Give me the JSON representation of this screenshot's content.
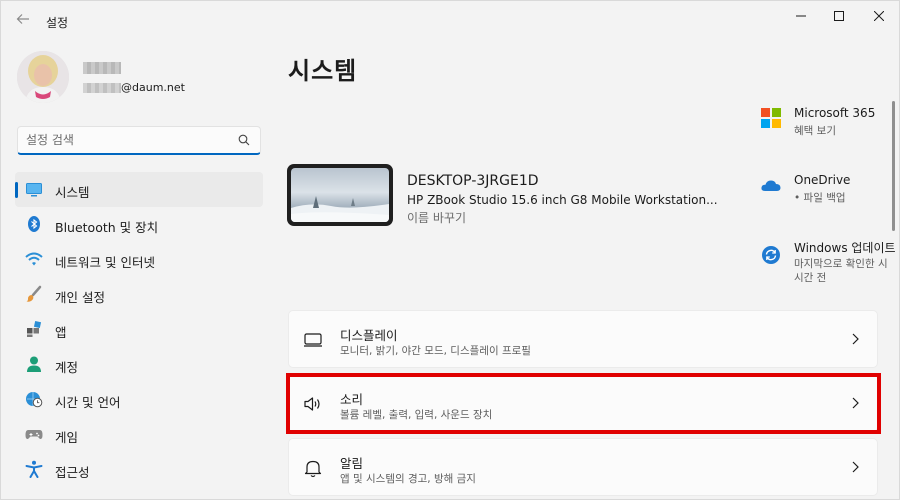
{
  "window": {
    "app_title": "설정",
    "controls": [
      "minimize-icon",
      "maximize-icon",
      "close-icon"
    ]
  },
  "profile": {
    "email_suffix": "@daum.net"
  },
  "search": {
    "placeholder": "설정 검색",
    "icon": "search-icon"
  },
  "sidebar": {
    "items": [
      {
        "label": "시스템",
        "icon": "monitor-icon",
        "active": true
      },
      {
        "label": "Bluetooth 및 장치",
        "icon": "bluetooth-icon"
      },
      {
        "label": "네트워크 및 인터넷",
        "icon": "wifi-icon"
      },
      {
        "label": "개인 설정",
        "icon": "brush-icon"
      },
      {
        "label": "앱",
        "icon": "apps-icon"
      },
      {
        "label": "계정",
        "icon": "account-icon"
      },
      {
        "label": "시간 및 언어",
        "icon": "globe-clock-icon"
      },
      {
        "label": "게임",
        "icon": "gamepad-icon"
      },
      {
        "label": "접근성",
        "icon": "accessibility-icon"
      }
    ]
  },
  "main": {
    "title": "시스템",
    "device": {
      "name": "DESKTOP-3JRGE1D",
      "model": "HP ZBook Studio 15.6 inch G8 Mobile Workstation...",
      "rename": "이름 바꾸기"
    },
    "side_cards": [
      {
        "title": "Microsoft 365",
        "sub": "혜택 보기",
        "icon": "microsoft-365-icon"
      },
      {
        "title": "OneDrive",
        "sub": "• 파일 백업",
        "icon": "onedrive-icon"
      },
      {
        "title": "Windows 업데이트",
        "sub": "마지막으로 확인한 시",
        "sub2": "시간 전",
        "icon": "windows-update-icon"
      }
    ],
    "settings": [
      {
        "title": "디스플레이",
        "sub": "모니터, 밝기, 야간 모드, 디스플레이 프로필",
        "icon": "display-icon"
      },
      {
        "title": "소리",
        "sub": "볼륨 레벨, 출력, 입력, 사운드 장치",
        "icon": "speaker-icon"
      },
      {
        "title": "알림",
        "sub": "앱 및 시스템의 경고, 방해 금지",
        "icon": "bell-icon"
      }
    ]
  },
  "colors": {
    "accent": "#0067c0",
    "highlight": "#e00000",
    "background": "#f3f3f3"
  }
}
